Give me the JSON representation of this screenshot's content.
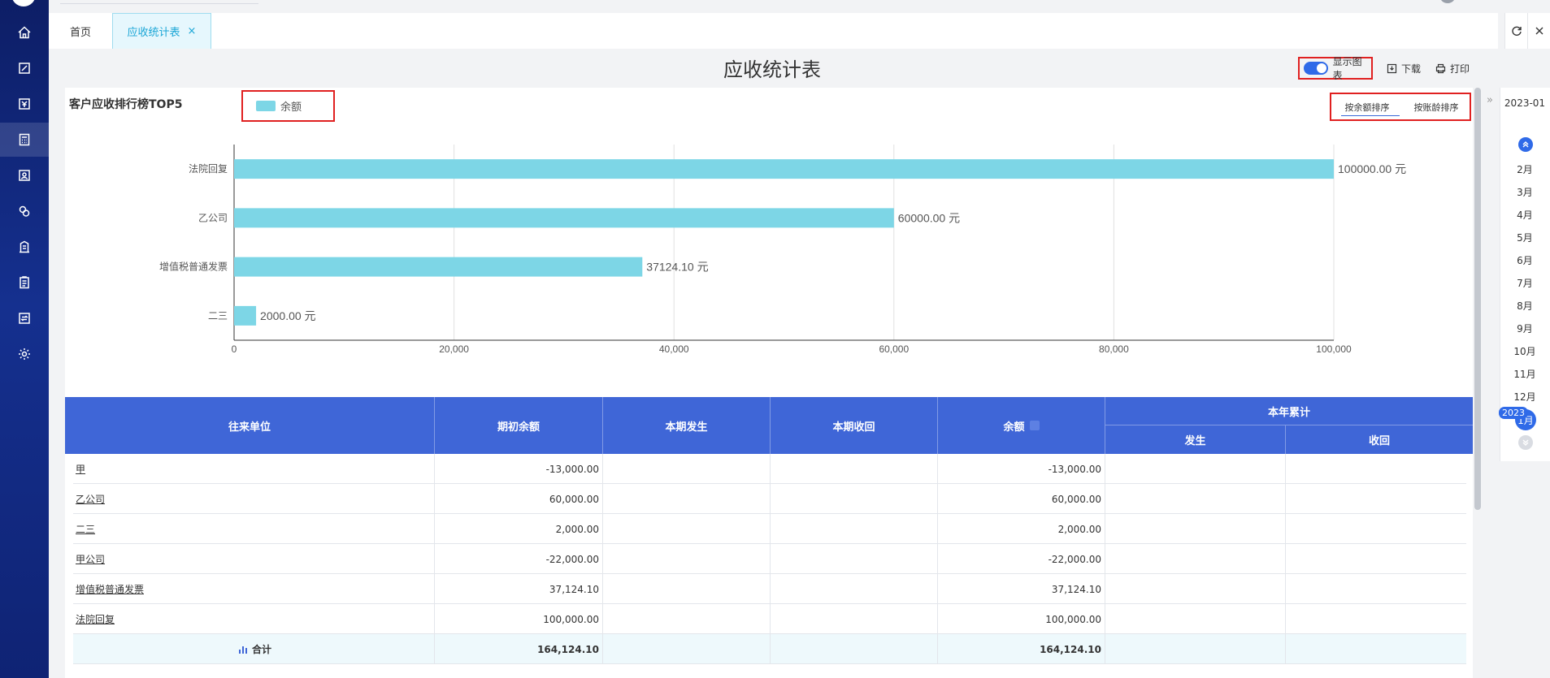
{
  "tabs": {
    "home": "首页",
    "receivables": "应收统计表",
    "close": "×"
  },
  "header": {
    "title": "应收统计表",
    "toggle_label": "显示图表",
    "download": "下载",
    "print": "打印"
  },
  "chart_section": {
    "title": "客户应收排行榜TOP5",
    "sort_by_balance": "按余额排序",
    "sort_by_age": "按账龄排序"
  },
  "chart_data": {
    "type": "bar",
    "orientation": "horizontal",
    "categories": [
      "法院回复",
      "乙公司",
      "增值税普通发票",
      "二三"
    ],
    "series": [
      {
        "name": "余额",
        "values": [
          100000,
          60000,
          37124.1,
          2000
        ],
        "color": "#7dd6e6"
      }
    ],
    "data_labels": [
      "100000.00 元",
      "60000.00 元",
      "37124.10 元",
      "2000.00 元"
    ],
    "xlim": [
      0,
      100000
    ],
    "xticks": [
      0,
      20000,
      40000,
      60000,
      80000,
      100000
    ],
    "xtick_labels": [
      "0",
      "20,000",
      "40,000",
      "60,000",
      "80,000",
      "100,000"
    ],
    "grid": true,
    "legend_position": "top-left"
  },
  "table": {
    "headers": {
      "partner": "往来单位",
      "opening": "期初余额",
      "period_occur": "本期发生",
      "period_recover": "本期收回",
      "balance": "余额",
      "year_total": "本年累计",
      "year_occur": "发生",
      "year_recover": "收回"
    },
    "rows": [
      {
        "partner": "甲",
        "opening": "-13,000.00",
        "period_occur": "",
        "period_recover": "",
        "balance": "-13,000.00",
        "year_occur": "",
        "year_recover": ""
      },
      {
        "partner": "乙公司",
        "opening": "60,000.00",
        "period_occur": "",
        "period_recover": "",
        "balance": "60,000.00",
        "year_occur": "",
        "year_recover": ""
      },
      {
        "partner": "二三",
        "opening": "2,000.00",
        "period_occur": "",
        "period_recover": "",
        "balance": "2,000.00",
        "year_occur": "",
        "year_recover": ""
      },
      {
        "partner": "甲公司",
        "opening": "-22,000.00",
        "period_occur": "",
        "period_recover": "",
        "balance": "-22,000.00",
        "year_occur": "",
        "year_recover": ""
      },
      {
        "partner": "增值税普通发票",
        "opening": "37,124.10",
        "period_occur": "",
        "period_recover": "",
        "balance": "37,124.10",
        "year_occur": "",
        "year_recover": ""
      },
      {
        "partner": "法院回复",
        "opening": "100,000.00",
        "period_occur": "",
        "period_recover": "",
        "balance": "100,000.00",
        "year_occur": "",
        "year_recover": ""
      }
    ],
    "total": {
      "label": "合计",
      "opening": "164,124.10",
      "period_occur": "",
      "period_recover": "",
      "balance": "164,124.10",
      "year_occur": "",
      "year_recover": ""
    }
  },
  "month_panel": {
    "year_label": "2023-01",
    "months": [
      "2月",
      "3月",
      "4月",
      "5月",
      "6月",
      "7月",
      "8月",
      "9月",
      "10月",
      "11月",
      "12月"
    ],
    "current_month": "1月",
    "current_year": "2023",
    "collapse": "»"
  },
  "icons": [
    "home-icon",
    "edit-icon",
    "yen-icon",
    "calculator-icon",
    "user-doc-icon",
    "coins-icon",
    "building-icon",
    "clipboard-icon",
    "exchange-icon",
    "gear-icon",
    "refresh-icon",
    "close-icon",
    "download-icon",
    "print-icon",
    "bar-chart-icon"
  ]
}
